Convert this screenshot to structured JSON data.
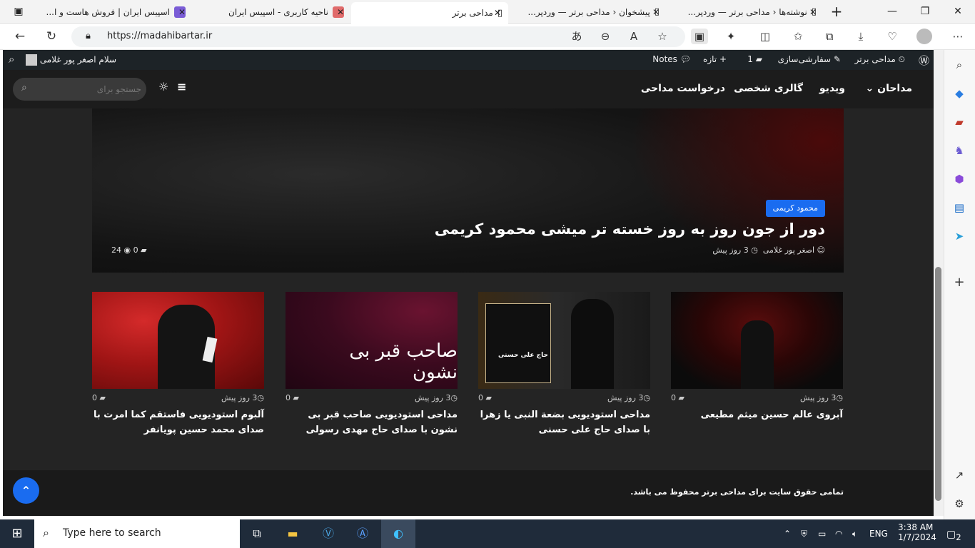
{
  "browser": {
    "tabs": [
      {
        "label": "اسپیس ایران | فروش هاست و ا...",
        "active": false
      },
      {
        "label": "ناحیه کاربری - اسپیس ایران",
        "active": false
      },
      {
        "label": "مداحی برتر",
        "active": true
      },
      {
        "label": "پیشخوان ‹ مداحی برتر — وردپر...",
        "active": false
      },
      {
        "label": "نوشته‌ها ‹ مداحی برتر — وردپر...",
        "active": false
      }
    ],
    "url": "https://madahibartar.ir"
  },
  "wp_admin_bar": {
    "site_name": "مداحی برتر",
    "customize": "سفارشی‌سازی",
    "comments_count": "1",
    "new_label": "تازه",
    "notes_label": "Notes",
    "greeting": "سلام اصغر پور غلامی"
  },
  "site_header": {
    "search_placeholder": "جستجو برای",
    "menu": [
      {
        "label": "مداحان"
      },
      {
        "label": "ویدیو"
      },
      {
        "label": "گالری شخصی"
      },
      {
        "label": "درخواست مداحی"
      }
    ]
  },
  "hero": {
    "category": "محمود کریمی",
    "title": "دور از جون روز به روز خسته تر میشی محمود کریمی",
    "author": "اصغر پور غلامی",
    "time": "3 روز پیش",
    "comments": "0",
    "views": "24"
  },
  "cards": [
    {
      "time": "3 روز پیش",
      "comments": "0",
      "title": "آبروی عالم حسین میثم مطیعی"
    },
    {
      "time": "3 روز پیش",
      "comments": "0",
      "title": "مداحی استودیویی بضعة النبی یا زهرا با صدای حاج علی حسنی",
      "img_text": "حاج علی حسنی"
    },
    {
      "time": "3 روز پیش",
      "comments": "0",
      "title": "مداحی استودیویی صاحب قبر بی نشون با صدای حاج مهدی رسولی",
      "img_text": "صاحب قبر بی نشون"
    },
    {
      "time": "3 روز پیش",
      "comments": "0",
      "title": "آلبوم استودیویی فاستقم کما امرت با صدای محمد حسین پویانفر"
    }
  ],
  "footer": {
    "copyright": "تمامی حقوق سایت برای مداحی برتر محفوظ می باشد."
  },
  "taskbar": {
    "search_placeholder": "Type here to search",
    "lang": "ENG",
    "time": "3:38 AM",
    "date": "1/7/2024",
    "notifications": "2"
  }
}
